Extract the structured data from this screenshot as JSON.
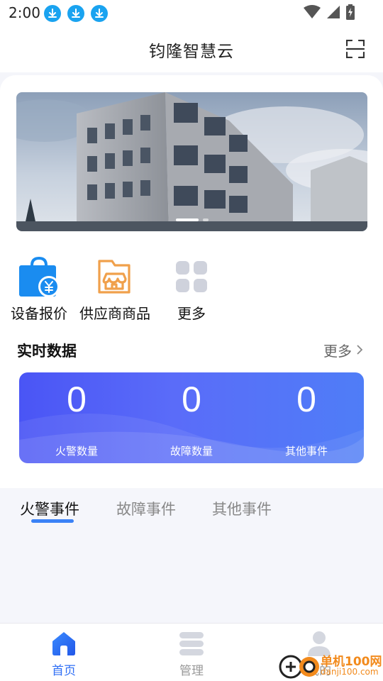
{
  "status_bar": {
    "time": "2:00",
    "icons": [
      "download-icon",
      "download-icon",
      "download-icon",
      "wifi-icon",
      "signal-icon",
      "battery-charging-icon"
    ]
  },
  "header": {
    "title": "钧隆智慧云",
    "scan_icon": "scan-icon"
  },
  "banner": {
    "slide_count": 2,
    "active_slide": 1
  },
  "quick_actions": [
    {
      "label": "设备报价",
      "icon": "shopping-bag-yuan-icon"
    },
    {
      "label": "供应商商品",
      "icon": "store-folder-icon"
    },
    {
      "label": "更多",
      "icon": "grid-icon"
    }
  ],
  "realtime": {
    "title": "实时数据",
    "more_label": "更多",
    "stats": [
      {
        "value": "0",
        "label": "火警数量"
      },
      {
        "value": "0",
        "label": "故障数量"
      },
      {
        "value": "0",
        "label": "其他事件"
      }
    ]
  },
  "tabs": [
    {
      "label": "火警事件",
      "active": true
    },
    {
      "label": "故障事件",
      "active": false
    },
    {
      "label": "其他事件",
      "active": false
    }
  ],
  "bottom_nav": [
    {
      "label": "首页",
      "icon": "home-icon",
      "active": true
    },
    {
      "label": "管理",
      "icon": "server-list-icon",
      "active": false
    },
    {
      "label": "我的",
      "icon": "user-icon",
      "active": false
    }
  ],
  "watermark": {
    "text": "单机100网",
    "url_text": "danji100.com"
  },
  "colors": {
    "accent": "#2f6ff5",
    "card_gradient_start": "#4a55f5",
    "card_gradient_end": "#4f7df7",
    "bag_blue": "#1a8cf0",
    "store_orange": "#f0a04b",
    "grid_gray": "#cfd2dc"
  }
}
